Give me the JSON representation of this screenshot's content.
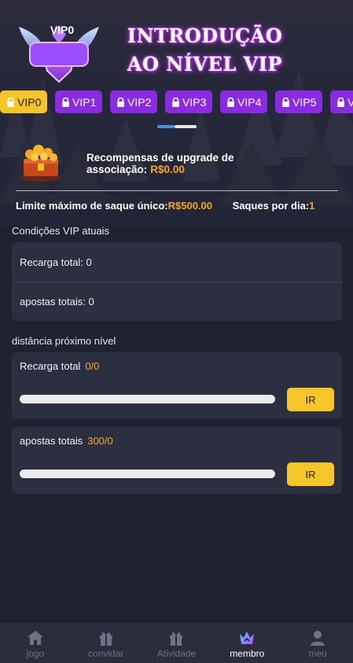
{
  "header": {
    "badge_label": "VIP0",
    "title_line1": "INTRODUÇÃO",
    "title_line2": "AO NÍVEL VIP"
  },
  "vip_tabs": [
    {
      "label": "VIP0",
      "active": true
    },
    {
      "label": "VIP1",
      "active": false
    },
    {
      "label": "VIP2",
      "active": false
    },
    {
      "label": "VIP3",
      "active": false
    },
    {
      "label": "VIP4",
      "active": false
    },
    {
      "label": "VIP5",
      "active": false
    },
    {
      "label": "V",
      "active": false
    }
  ],
  "reward": {
    "label": "Recompensas de upgrade de associação:",
    "value": "R$0.00",
    "icon": "treasure-chest-icon"
  },
  "limits": {
    "max_withdraw_label": "Limite máximo de saque único:",
    "max_withdraw_value": "R$500.00",
    "per_day_label": "Saques por dia:",
    "per_day_value": "1"
  },
  "current_conditions": {
    "title": "Condições VIP atuais",
    "rows": [
      {
        "label": "Recarga total: 0"
      },
      {
        "label": "apostas totais: 0"
      }
    ]
  },
  "next_level": {
    "title": "distância próximo nível",
    "items": [
      {
        "label": "Recarga total",
        "value": "0/0",
        "progress": 0,
        "button": "IR"
      },
      {
        "label": "apostas totais",
        "value": "300/0",
        "progress": 0,
        "button": "IR"
      }
    ]
  },
  "nav": [
    {
      "label": "jogo",
      "icon": "home-icon",
      "active": false
    },
    {
      "label": "convidar",
      "icon": "gift-icon",
      "active": false
    },
    {
      "label": "Atividade",
      "icon": "gift-icon",
      "active": false
    },
    {
      "label": "membro",
      "icon": "crown-icon",
      "active": true
    },
    {
      "label": "meu",
      "icon": "user-icon",
      "active": false
    }
  ],
  "colors": {
    "accent_gold": "#f5a623",
    "tab_purple": "#8a2be2",
    "tab_active": "#f5c52a",
    "background": "#1f2231",
    "card": "#2c2f40"
  }
}
